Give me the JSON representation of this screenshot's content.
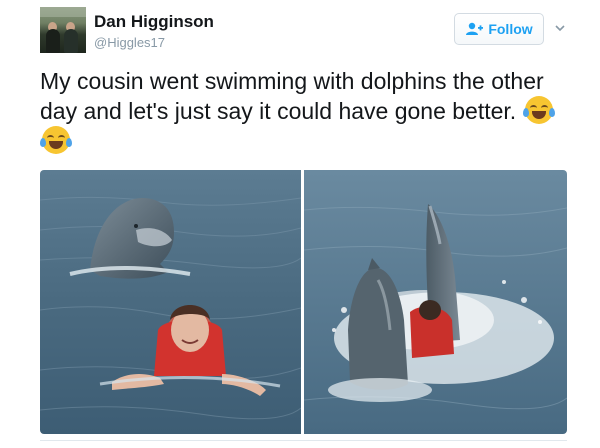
{
  "tweet": {
    "display_name": "Dan Higginson",
    "handle": "@Higgles17",
    "text": "My cousin went swimming with dolphins the other day and let's just say it could have gone better.",
    "emoji_icons": [
      "face-with-tears-of-joy-icon",
      "face-with-tears-of-joy-icon"
    ]
  },
  "actions": {
    "follow_label": "Follow"
  },
  "colors": {
    "accent": "#1da1f2",
    "name": "#14171a",
    "handle": "#8899a6"
  }
}
